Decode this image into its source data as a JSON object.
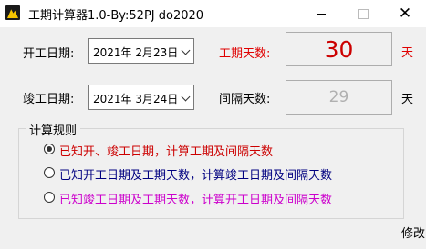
{
  "window": {
    "title": "工期计算器1.0-By:52PJ do2020",
    "close_glyph": "✕"
  },
  "form": {
    "start_date_label": "开工日期:",
    "start_date_value": "2021年  2月23日",
    "end_date_label": "竣工日期:",
    "end_date_value": "2021年  3月24日",
    "duration_label": "工期天数:",
    "duration_value": "30",
    "duration_unit": "天",
    "interval_label": "间隔天数:",
    "interval_value": "29",
    "interval_unit": "天"
  },
  "rules": {
    "title": "计算规则",
    "options": [
      {
        "label": "已知开、竣工日期，计算工期及间隔天数",
        "selected": true,
        "color": "#cc0000"
      },
      {
        "label": "已知开工日期及工期天数，计算竣工日期及间隔天数",
        "selected": false,
        "color": "#000080"
      },
      {
        "label": "已知竣工日期及工期天数，计算开工日期及间隔天数",
        "selected": false,
        "color": "#cc00cc"
      }
    ]
  },
  "footer": {
    "modify_label": "修改"
  },
  "colors": {
    "accent_red": "#e00000",
    "result_red": "#cc0000",
    "disabled_gray": "#b0b0b0"
  }
}
